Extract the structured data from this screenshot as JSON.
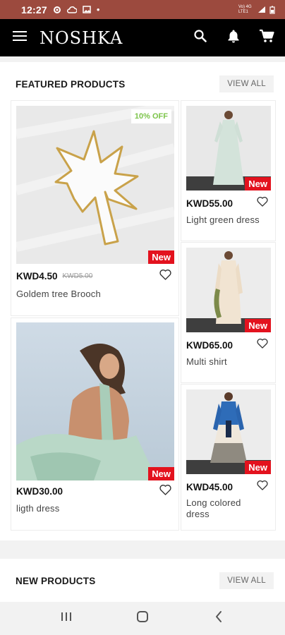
{
  "status": {
    "time": "12:27",
    "network": "Vo) 4G LTE1",
    "dot": "•"
  },
  "app": {
    "brand": "NOSHKA"
  },
  "featured": {
    "title": "FEATURED PRODUCTS",
    "view_all": "VIEW ALL",
    "products": [
      {
        "price": "KWD4.50",
        "old_price": "KWD5.00",
        "name": "Goldem tree Brooch",
        "discount": "10% OFF",
        "badge": "New"
      },
      {
        "price": "KWD55.00",
        "name": "Light green dress",
        "badge": "New"
      },
      {
        "price": "KWD65.00",
        "name": "Multi shirt",
        "badge": "New"
      },
      {
        "price": "KWD30.00",
        "name": "ligth dress",
        "badge": "New"
      },
      {
        "price": "KWD45.00",
        "name": "Long colored dress",
        "badge": "New"
      }
    ]
  },
  "new_products": {
    "title": "NEW PRODUCTS",
    "view_all": "VIEW ALL"
  },
  "colors": {
    "status_bar": "#9c4a3e",
    "app_bar": "#000000",
    "badge_new": "#e3121e",
    "discount": "#7cc44a"
  }
}
